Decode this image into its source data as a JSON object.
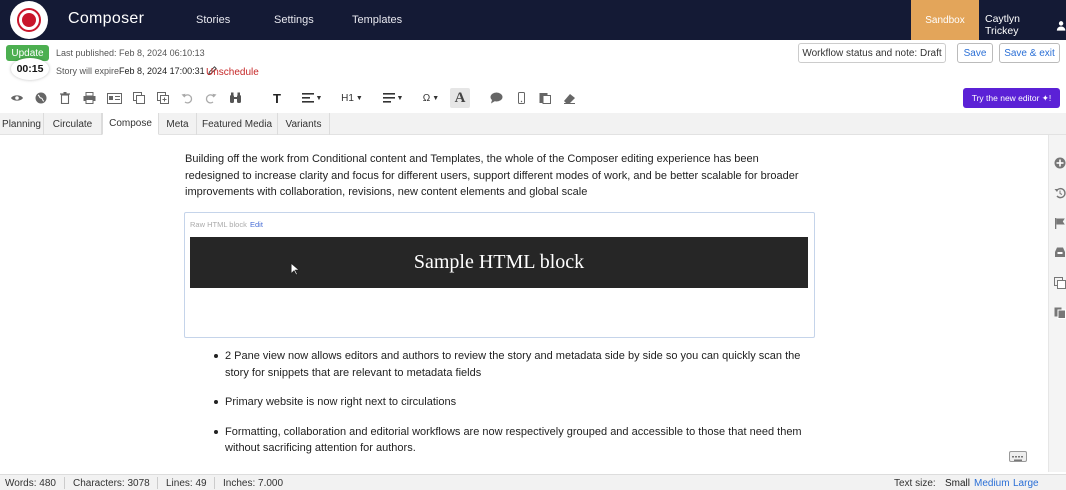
{
  "app": {
    "brand": "Composer",
    "nav": [
      "Stories",
      "Settings",
      "Templates"
    ],
    "environment": "Sandbox",
    "user_name": "Caytlyn Trickey"
  },
  "publish": {
    "update_label": "Update",
    "timer": "00:15",
    "last_published": "Last published: Feb 8, 2024 06:10:13",
    "expire_prefix": "Story will expire ",
    "expire_date": "Feb 8, 2024 17:00:31",
    "unschedule": "Unschedule",
    "workflow_status": "Workflow status and note: Draft",
    "save": "Save",
    "save_exit": "Save & exit"
  },
  "toolbar": {
    "heading_dropdown": "H1",
    "text_icon": "T",
    "font_icon": "A",
    "special_char": "Ω",
    "new_editor": "Try the new editor ✦!"
  },
  "tabs": [
    {
      "label": "Planning",
      "active": false
    },
    {
      "label": "Circulate",
      "active": false
    },
    {
      "label": "Compose",
      "active": true
    },
    {
      "label": "Meta",
      "active": false
    },
    {
      "label": "Featured Media",
      "active": false
    },
    {
      "label": "Variants",
      "active": false
    }
  ],
  "content": {
    "intro": "Building off the work from Conditional content and Templates, the whole of the Composer editing experience has been redesigned to increase clarity and focus for different users, support different modes of work, and be better scalable for broader improvements with collaboration, revisions, new content elements and global scale",
    "html_block": {
      "label": "Raw HTML block",
      "edit": "Edit",
      "sample": "Sample HTML block"
    },
    "bullets": [
      "2 Pane view now allows editors and authors to review the story and metadata side by side so you can quickly scan the story for snippets that are relevant to metadata fields",
      "Primary website is now right next to circulations",
      "Formatting, collaboration and editorial workflows are now respectively grouped and accessible to those that need them without sacrificing attention for authors."
    ]
  },
  "status": {
    "words": "Words: 480",
    "characters": "Characters: 3078",
    "lines": "Lines: 49",
    "inches": "Inches: 7.000",
    "text_size_label": "Text size:",
    "sizes": [
      "Small",
      "Medium",
      "Large"
    ]
  },
  "colors": {
    "nav_bg": "#141a35",
    "sandbox": "#e3a55a",
    "accent_purple": "#5b21d6",
    "update_green": "#4caf50",
    "unschedule_red": "#c62828"
  }
}
